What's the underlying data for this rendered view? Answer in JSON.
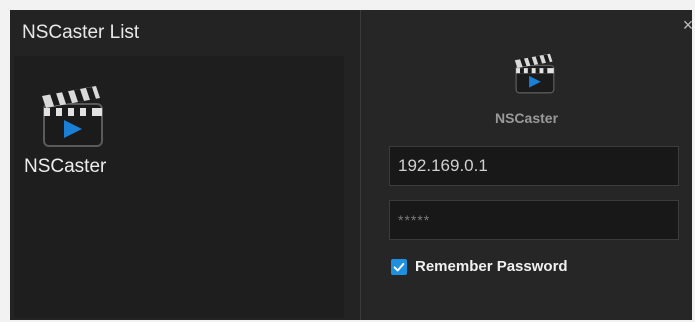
{
  "left": {
    "title": "NSCaster List",
    "device": {
      "name": "NSCaster",
      "icon": "clapperboard-play-icon"
    }
  },
  "right": {
    "close_icon": "×",
    "device_icon": "clapperboard-play-icon",
    "device_caption": "NSCaster",
    "ip_value": "192.169.0.1",
    "password_value": "*****",
    "remember": {
      "label": "Remember Password",
      "checked": true
    }
  },
  "colors": {
    "background": "#232323",
    "accent": "#1f8fe0",
    "play_blue": "#1a7fd6"
  }
}
